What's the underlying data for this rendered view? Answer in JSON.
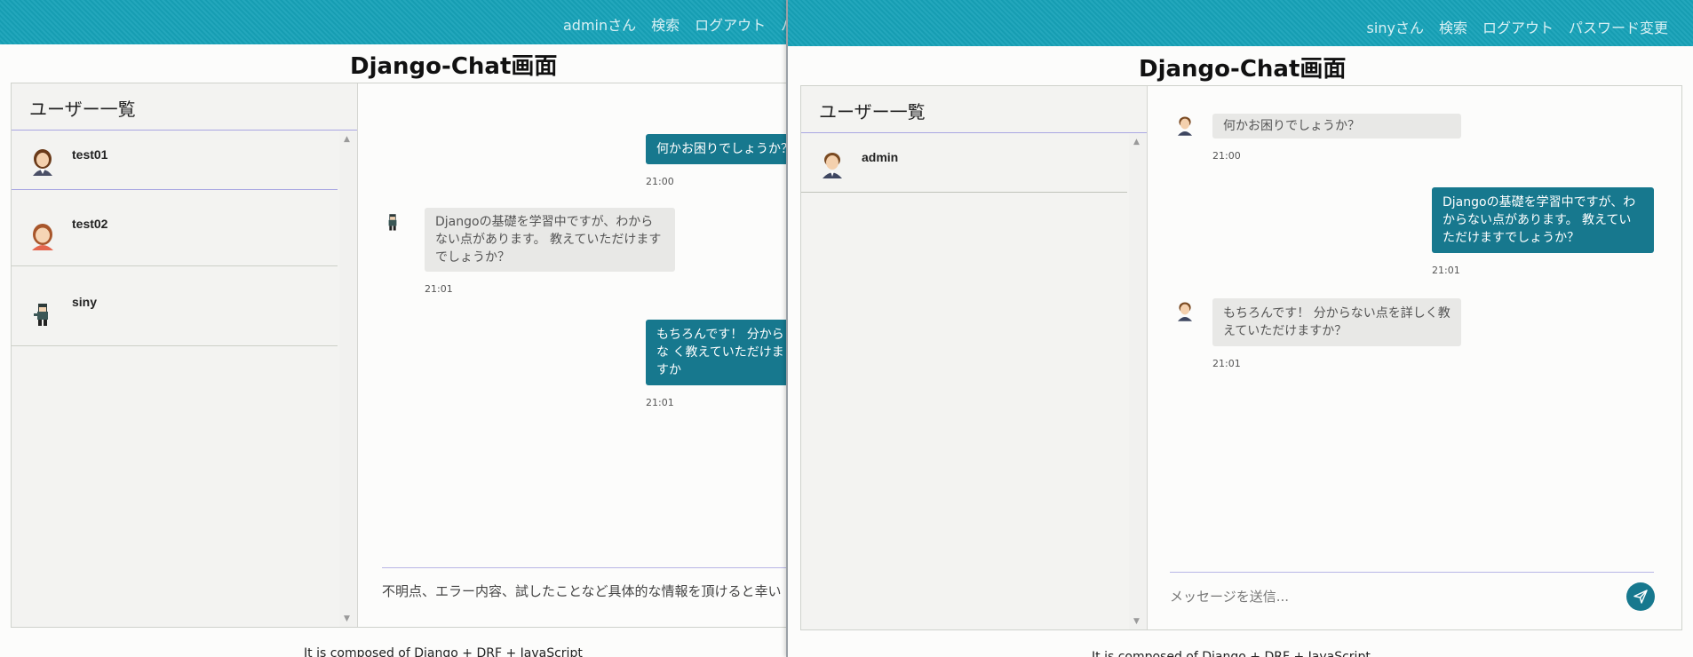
{
  "colors": {
    "navbar": "#17a2b8",
    "my_bubble": "#17788e",
    "their_bubble": "#e8e8e6"
  },
  "left_window": {
    "nav": [
      "adminさん",
      "検索",
      "ログアウト",
      "パ"
    ],
    "title": "Django-Chat画面",
    "users_header": "ユーザー一覧",
    "users": [
      "test01",
      "test02",
      "siny"
    ],
    "messages": [
      {
        "text": "何かお困りでしょうか？",
        "time": "21:00"
      },
      {
        "text": "Djangoの基礎を学習中ですが、わからない点があります。 教えていただけますでしょうか？",
        "time": "21:01"
      },
      {
        "text": "もちろんです！ 分からな く教えていただけますか",
        "time": "21:01"
      }
    ],
    "input_text": "不明点、エラー内容、試したことなど具体的な情報を頂けると幸い",
    "footer": "It is composed of Django + DRF + JavaScript"
  },
  "right_window": {
    "nav": [
      "sinyさん",
      "検索",
      "ログアウト",
      "パスワード変更"
    ],
    "title": "Django-Chat画面",
    "users_header": "ユーザー一覧",
    "users": [
      "admin"
    ],
    "messages": [
      {
        "text": "何かお困りでしょうか？",
        "time": "21:00"
      },
      {
        "text": "Djangoの基礎を学習中ですが、わからない点があります。 教えていただけますでしょうか？",
        "time": "21:01"
      },
      {
        "text": "もちろんです！ 分からない点を詳しく教えていただけますか？",
        "time": "21:01"
      }
    ],
    "input_placeholder": "メッセージを送信...",
    "footer": "It is composed of Django + DRF + JavaScript"
  }
}
